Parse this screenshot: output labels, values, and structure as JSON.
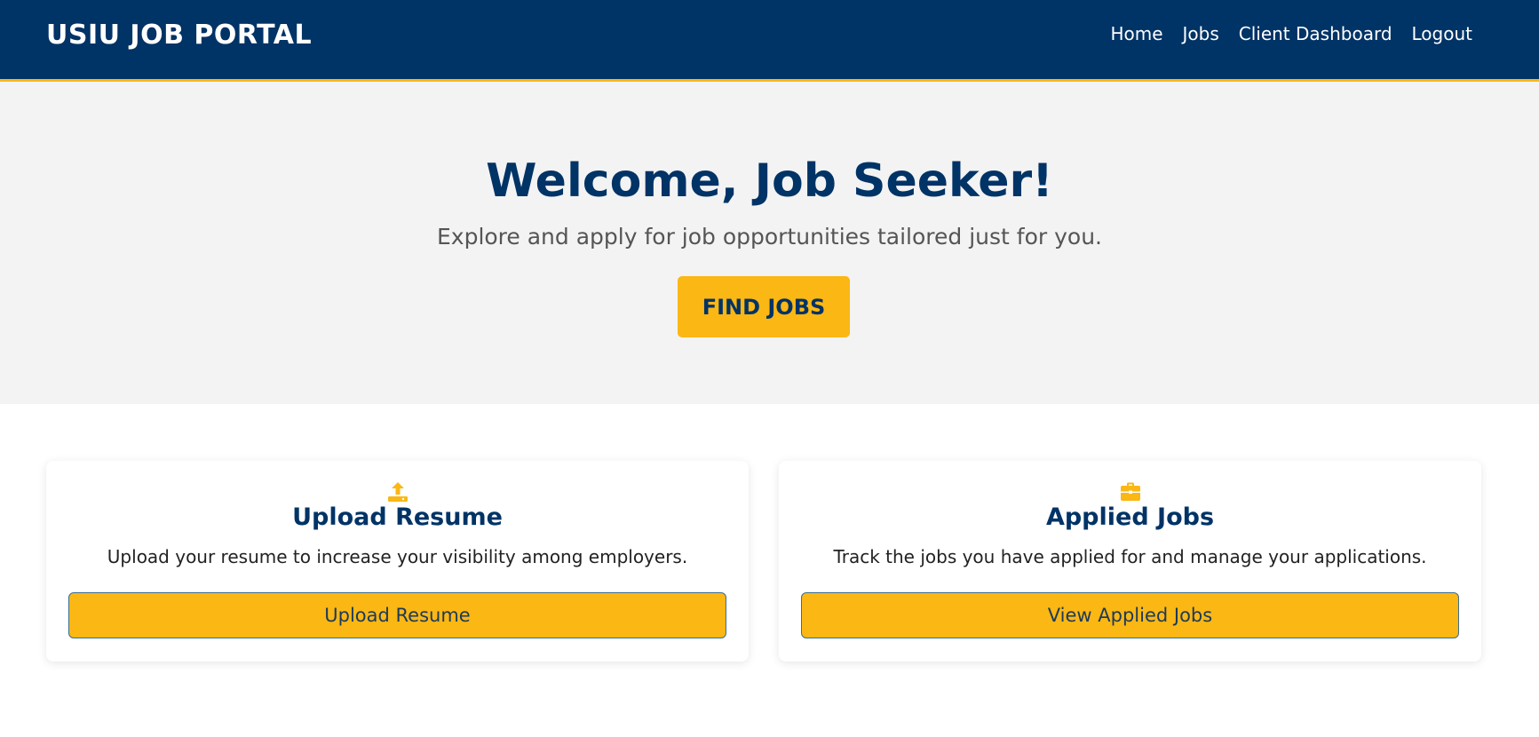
{
  "header": {
    "brand": "USIU JOB PORTAL",
    "nav": [
      "Home",
      "Jobs",
      "Client Dashboard",
      "Logout"
    ]
  },
  "hero": {
    "title": "Welcome, Job Seeker!",
    "subtitle": "Explore and apply for job opportunities tailored just for you.",
    "button_label": "FIND JOBS"
  },
  "cards": [
    {
      "icon": "upload-icon",
      "title": "Upload Resume",
      "description": "Upload your resume to increase your visibility among employers.",
      "button_label": "Upload Resume"
    },
    {
      "icon": "briefcase-icon",
      "title": "Applied Jobs",
      "description": "Track the jobs you have applied for and manage your applications.",
      "button_label": "View Applied Jobs"
    }
  ],
  "colors": {
    "navy": "#003366",
    "accent": "#fbb714",
    "hero_bg": "#f3f3f3"
  }
}
